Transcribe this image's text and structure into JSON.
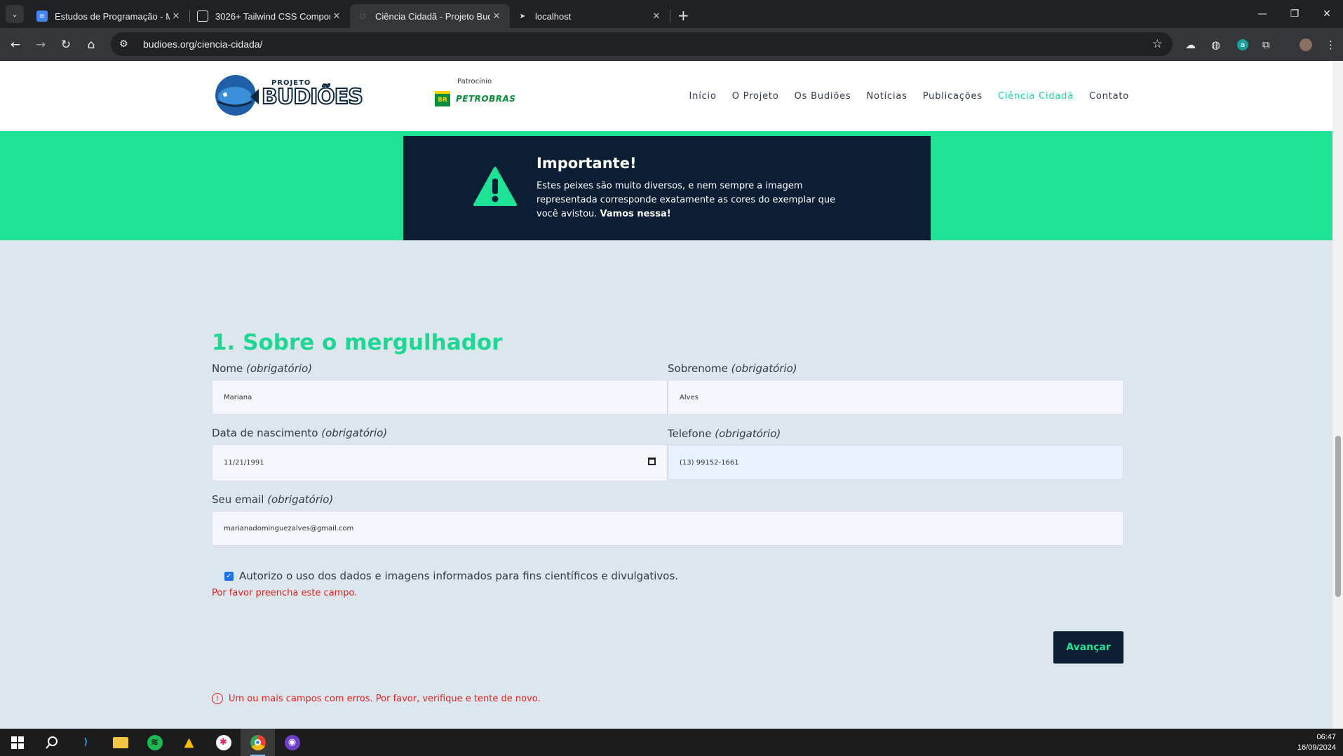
{
  "browser": {
    "tabs": [
      {
        "title": "Estudos de Programação - Mes",
        "favicon_color": "#4285f4",
        "active": false
      },
      {
        "title": "3026+ Tailwind CSS Componen",
        "favicon_color": "#e8eaed",
        "active": false
      },
      {
        "title": "Ciência Cidadã - Projeto Budiõe",
        "favicon_color": "#9aa0a6",
        "active": true
      },
      {
        "title": "localhost",
        "favicon_color": "#e8eaed",
        "active": false
      }
    ],
    "url": "budioes.org/ciencia-cidada/"
  },
  "header": {
    "logo": {
      "small": "PROJETO",
      "big": "BUDIÕES"
    },
    "sponsor": {
      "label": "Patrocínio",
      "br": "BR",
      "name": "PETROBRAS"
    },
    "nav": [
      "Início",
      "O Projeto",
      "Os Budiões",
      "Notícias",
      "Publicações",
      "Ciência Cidadã",
      "Contato"
    ],
    "nav_current": "Ciência Cidadã",
    "accent": "#1ed795"
  },
  "notice": {
    "title": "Importante!",
    "text": "Estes peixes são muito diversos, e nem sempre a imagem representada corresponde exatamente as cores do exemplar que você avistou.",
    "emphasis": "Vamos nessa!"
  },
  "form": {
    "section_title": "1. Sobre o mergulhador",
    "required_tag": "(obrigatório)",
    "fields": {
      "nome": {
        "label": "Nome",
        "value": "Mariana"
      },
      "sobrenome": {
        "label": "Sobrenome",
        "value": "Alves"
      },
      "nascimento": {
        "label": "Data de nascimento",
        "value": "11/21/1991"
      },
      "telefone": {
        "label": "Telefone",
        "value": "(13) 99152-1661"
      },
      "email": {
        "label": "Seu email",
        "value": "marianadominguezalves@gmail.com"
      }
    },
    "consent": "Autorizo o uso dos dados e imagens informados para fins científicos e divulgativos.",
    "consent_checked": true,
    "field_error": "Por favor preencha este campo.",
    "next_button": "Avançar",
    "form_error": "Um ou mais campos com erros. Por favor, verifique e tente de novo."
  },
  "taskbar": {
    "time": "06:47",
    "date": "16/09/2024"
  }
}
